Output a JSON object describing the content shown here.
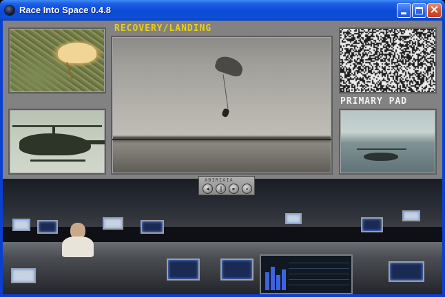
{
  "window": {
    "title": "Race Into Space 0.4.8",
    "close_glyph": "×"
  },
  "screen": {
    "main_label": "RECOVERY/LANDING",
    "pad_label": "PRIMARY PAD",
    "control_strip_label": "ABIRIAIA"
  },
  "icons": {
    "app": "app-icon",
    "minimize": "minimize-icon",
    "maximize": "maximize-icon",
    "close": "close-icon",
    "playback": [
      "rewind-icon",
      "pause-icon",
      "play-icon",
      "fast-forward-icon"
    ]
  },
  "colors": {
    "screen_label": "#e7cf18",
    "pad_label": "#f0f0f0",
    "panel_gray": "#828282",
    "titlebar_blue": "#0a4ad6"
  }
}
